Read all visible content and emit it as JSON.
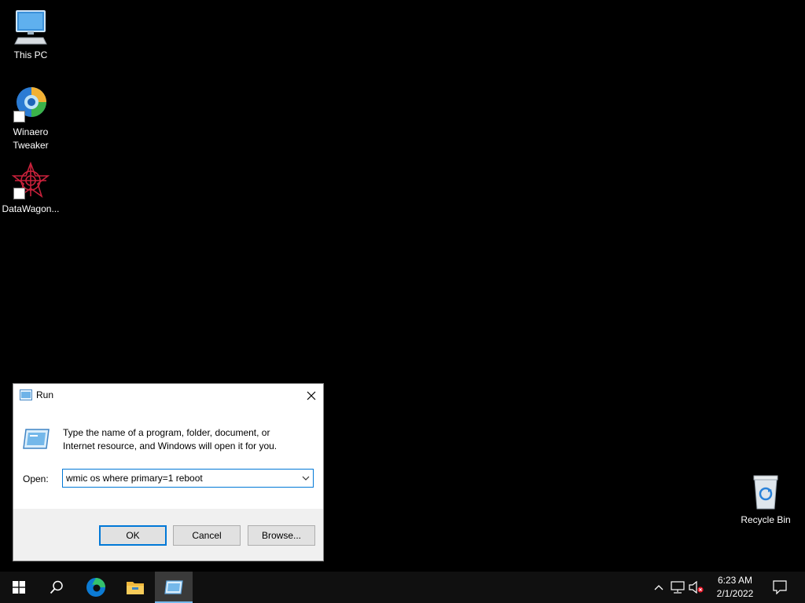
{
  "desktop": {
    "icons": [
      {
        "label": "This PC",
        "icon": "computer-icon"
      },
      {
        "label": "Winaero Tweaker",
        "icon": "winaero-tweaker-icon"
      },
      {
        "label": "DataWagon...",
        "icon": "datawagon-icon"
      },
      {
        "label": "Recycle Bin",
        "icon": "recycle-bin-icon"
      }
    ]
  },
  "run_dialog": {
    "title": "Run",
    "description": "Type the name of a program, folder, document, or Internet resource, and Windows will open it for you.",
    "open_label": "Open:",
    "open_value": "wmic os where primary=1 reboot",
    "ok_label": "OK",
    "cancel_label": "Cancel",
    "browse_label": "Browse..."
  },
  "taskbar": {
    "items": [
      {
        "icon": "windows-start-icon"
      },
      {
        "icon": "search-icon"
      },
      {
        "icon": "edge-icon"
      },
      {
        "icon": "file-explorer-icon"
      },
      {
        "icon": "run-icon",
        "active": true
      }
    ],
    "tray": {
      "icons": [
        "chevron-up-icon",
        "network-icon",
        "volume-muted-icon"
      ],
      "time": "6:23 AM",
      "date": "2/1/2022"
    }
  },
  "colors": {
    "accent": "#0078d7",
    "taskbar": "#101010",
    "dialog_bg": "#f0f0f0"
  }
}
